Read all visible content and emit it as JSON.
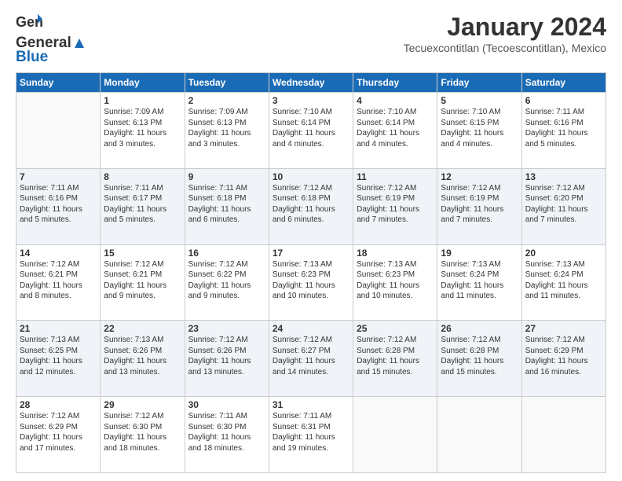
{
  "header": {
    "logo_general": "General",
    "logo_blue": "Blue",
    "title": "January 2024",
    "location": "Tecuexcontitlan (Tecoescontitlan), Mexico"
  },
  "calendar": {
    "days_of_week": [
      "Sunday",
      "Monday",
      "Tuesday",
      "Wednesday",
      "Thursday",
      "Friday",
      "Saturday"
    ],
    "weeks": [
      [
        {
          "day": "",
          "info": ""
        },
        {
          "day": "1",
          "info": "Sunrise: 7:09 AM\nSunset: 6:13 PM\nDaylight: 11 hours\nand 3 minutes."
        },
        {
          "day": "2",
          "info": "Sunrise: 7:09 AM\nSunset: 6:13 PM\nDaylight: 11 hours\nand 3 minutes."
        },
        {
          "day": "3",
          "info": "Sunrise: 7:10 AM\nSunset: 6:14 PM\nDaylight: 11 hours\nand 4 minutes."
        },
        {
          "day": "4",
          "info": "Sunrise: 7:10 AM\nSunset: 6:14 PM\nDaylight: 11 hours\nand 4 minutes."
        },
        {
          "day": "5",
          "info": "Sunrise: 7:10 AM\nSunset: 6:15 PM\nDaylight: 11 hours\nand 4 minutes."
        },
        {
          "day": "6",
          "info": "Sunrise: 7:11 AM\nSunset: 6:16 PM\nDaylight: 11 hours\nand 5 minutes."
        }
      ],
      [
        {
          "day": "7",
          "info": "Sunrise: 7:11 AM\nSunset: 6:16 PM\nDaylight: 11 hours\nand 5 minutes."
        },
        {
          "day": "8",
          "info": "Sunrise: 7:11 AM\nSunset: 6:17 PM\nDaylight: 11 hours\nand 5 minutes."
        },
        {
          "day": "9",
          "info": "Sunrise: 7:11 AM\nSunset: 6:18 PM\nDaylight: 11 hours\nand 6 minutes."
        },
        {
          "day": "10",
          "info": "Sunrise: 7:12 AM\nSunset: 6:18 PM\nDaylight: 11 hours\nand 6 minutes."
        },
        {
          "day": "11",
          "info": "Sunrise: 7:12 AM\nSunset: 6:19 PM\nDaylight: 11 hours\nand 7 minutes."
        },
        {
          "day": "12",
          "info": "Sunrise: 7:12 AM\nSunset: 6:19 PM\nDaylight: 11 hours\nand 7 minutes."
        },
        {
          "day": "13",
          "info": "Sunrise: 7:12 AM\nSunset: 6:20 PM\nDaylight: 11 hours\nand 7 minutes."
        }
      ],
      [
        {
          "day": "14",
          "info": "Sunrise: 7:12 AM\nSunset: 6:21 PM\nDaylight: 11 hours\nand 8 minutes."
        },
        {
          "day": "15",
          "info": "Sunrise: 7:12 AM\nSunset: 6:21 PM\nDaylight: 11 hours\nand 9 minutes."
        },
        {
          "day": "16",
          "info": "Sunrise: 7:12 AM\nSunset: 6:22 PM\nDaylight: 11 hours\nand 9 minutes."
        },
        {
          "day": "17",
          "info": "Sunrise: 7:13 AM\nSunset: 6:23 PM\nDaylight: 11 hours\nand 10 minutes."
        },
        {
          "day": "18",
          "info": "Sunrise: 7:13 AM\nSunset: 6:23 PM\nDaylight: 11 hours\nand 10 minutes."
        },
        {
          "day": "19",
          "info": "Sunrise: 7:13 AM\nSunset: 6:24 PM\nDaylight: 11 hours\nand 11 minutes."
        },
        {
          "day": "20",
          "info": "Sunrise: 7:13 AM\nSunset: 6:24 PM\nDaylight: 11 hours\nand 11 minutes."
        }
      ],
      [
        {
          "day": "21",
          "info": "Sunrise: 7:13 AM\nSunset: 6:25 PM\nDaylight: 11 hours\nand 12 minutes."
        },
        {
          "day": "22",
          "info": "Sunrise: 7:13 AM\nSunset: 6:26 PM\nDaylight: 11 hours\nand 13 minutes."
        },
        {
          "day": "23",
          "info": "Sunrise: 7:12 AM\nSunset: 6:26 PM\nDaylight: 11 hours\nand 13 minutes."
        },
        {
          "day": "24",
          "info": "Sunrise: 7:12 AM\nSunset: 6:27 PM\nDaylight: 11 hours\nand 14 minutes."
        },
        {
          "day": "25",
          "info": "Sunrise: 7:12 AM\nSunset: 6:28 PM\nDaylight: 11 hours\nand 15 minutes."
        },
        {
          "day": "26",
          "info": "Sunrise: 7:12 AM\nSunset: 6:28 PM\nDaylight: 11 hours\nand 15 minutes."
        },
        {
          "day": "27",
          "info": "Sunrise: 7:12 AM\nSunset: 6:29 PM\nDaylight: 11 hours\nand 16 minutes."
        }
      ],
      [
        {
          "day": "28",
          "info": "Sunrise: 7:12 AM\nSunset: 6:29 PM\nDaylight: 11 hours\nand 17 minutes."
        },
        {
          "day": "29",
          "info": "Sunrise: 7:12 AM\nSunset: 6:30 PM\nDaylight: 11 hours\nand 18 minutes."
        },
        {
          "day": "30",
          "info": "Sunrise: 7:11 AM\nSunset: 6:30 PM\nDaylight: 11 hours\nand 18 minutes."
        },
        {
          "day": "31",
          "info": "Sunrise: 7:11 AM\nSunset: 6:31 PM\nDaylight: 11 hours\nand 19 minutes."
        },
        {
          "day": "",
          "info": ""
        },
        {
          "day": "",
          "info": ""
        },
        {
          "day": "",
          "info": ""
        }
      ]
    ]
  }
}
